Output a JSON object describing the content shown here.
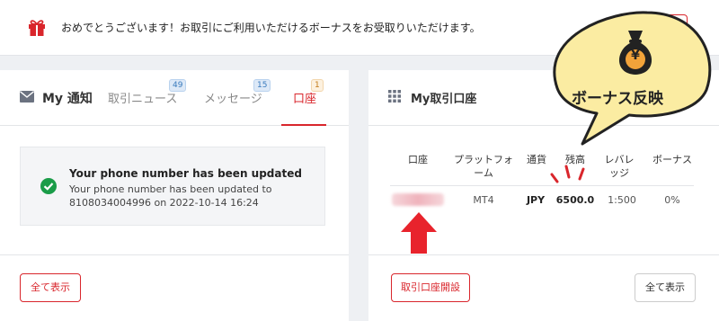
{
  "banner": {
    "message": "おめでとうございます！お取引にご利用いただけるボーナスをお受取りいただけます。",
    "icon": "gift-icon"
  },
  "notifications": {
    "title": "My 通知",
    "tabs": [
      {
        "label": "取引ニュース",
        "badge": "49"
      },
      {
        "label": "メッセージ",
        "badge": "15"
      },
      {
        "label": "口座",
        "badge": "1",
        "active": true
      }
    ],
    "notice": {
      "title": "Your phone number has been updated",
      "body": "Your phone number has been updated to 8108034004996 on 2022-10-14 16:24"
    },
    "show_all_label": "全て表示"
  },
  "accounts": {
    "title": "My取引口座",
    "columns": [
      "口座",
      "プラットフォーム",
      "通貨",
      "残高",
      "レバレッジ",
      "ボーナス"
    ],
    "rows": [
      {
        "account": "",
        "platform": "MT4",
        "currency": "JPY",
        "balance": "6500.0",
        "leverage": "1:500",
        "bonus": "0%"
      }
    ],
    "open_account_label": "取引口座開設",
    "show_all_label": "全て表示"
  },
  "callout": {
    "text": "ボーナス反映",
    "icon": "money-bag-yen-icon",
    "symbol": "¥"
  },
  "colors": {
    "accent_red": "#d9262c",
    "callout_yellow": "#fbeca2",
    "success_green": "#1a9c48"
  }
}
